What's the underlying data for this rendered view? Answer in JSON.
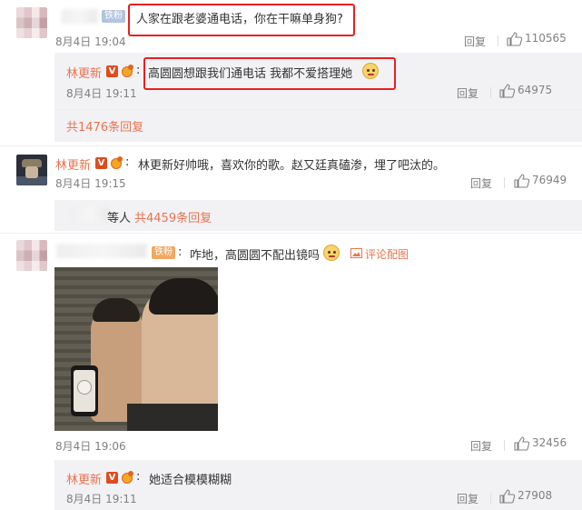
{
  "comments": [
    {
      "user_badge": "铁粉",
      "text": "人家在跟老婆通电话，你在干嘛单身狗?",
      "time": "8月4日 19:04",
      "reply_label": "回复",
      "likes": "110565",
      "replies": [
        {
          "user": "林更新",
          "verified": "V",
          "text": "高圆圆想跟我们通电话 我都不爱搭理她",
          "time": "8月4日 19:11",
          "reply_label": "回复",
          "likes": "64975"
        }
      ],
      "more_replies": "共1476条回复"
    },
    {
      "user": "林更新",
      "verified": "V",
      "text": "林更新好帅哦，喜欢你的歌。赵又廷真磕渗，埋了吧汰的。",
      "time": "8月4日 19:15",
      "reply_label": "回复",
      "likes": "76949",
      "reply_suffix": "等人",
      "more_replies": "共4459条回复"
    },
    {
      "user_badge": "铁粉",
      "text": "咋地，高圆圆不配出镜吗",
      "pic_link": "评论配图",
      "time": "8月4日 19:06",
      "reply_label": "回复",
      "likes": "32456",
      "replies": [
        {
          "user": "林更新",
          "verified": "V",
          "text": "她适合模模糊糊",
          "time": "8月4日 19:11",
          "reply_label": "回复",
          "likes": "27908"
        }
      ]
    }
  ],
  "colors": {
    "username": "#eb7350",
    "highlight_box": "#e82020",
    "meta": "#808080"
  },
  "icons": {
    "like": "thumbs-up-icon",
    "picture": "image-icon",
    "emoji": "doge-emoji-icon"
  }
}
